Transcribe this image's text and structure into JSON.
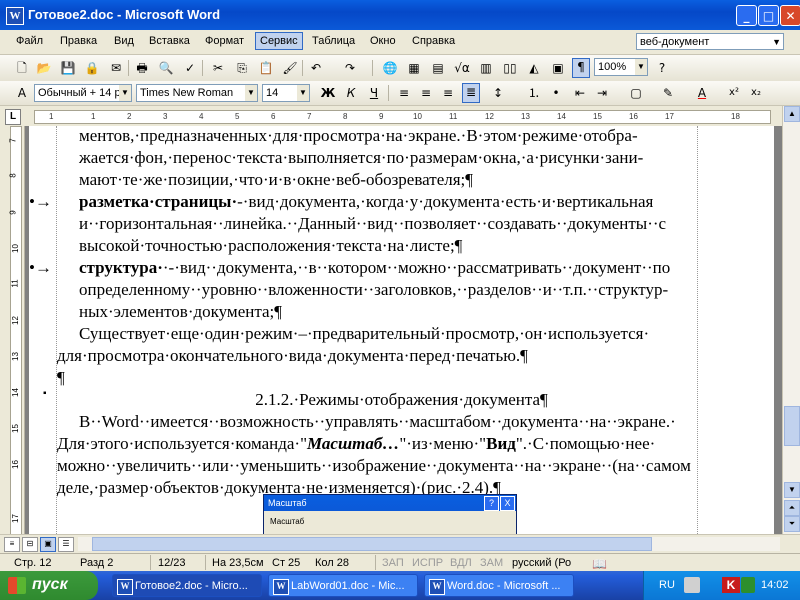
{
  "window": {
    "title": "Готовое2.doc - Microsoft Word",
    "app_icon": "W",
    "minimize_glyph": "_",
    "maximize_glyph": "□",
    "close_glyph": "✕"
  },
  "menubar": {
    "items": [
      "Файл",
      "Правка",
      "Вид",
      "Вставка",
      "Формат",
      "Сервис",
      "Таблица",
      "Окно",
      "Справка"
    ],
    "active": "Сервис",
    "help_box": "веб-документ"
  },
  "toolbar": {
    "zoom": "100%",
    "style": "Обычный + 14 р",
    "font": "Times New Roman",
    "size": "14",
    "bold": "Ж",
    "italic": "К",
    "underline": "Ч"
  },
  "ruler": {
    "tab_marker": "L",
    "ticks": [
      "1",
      "1",
      "2",
      "3",
      "4",
      "5",
      "6",
      "7",
      "8",
      "9",
      "10",
      "11",
      "12",
      "13",
      "14",
      "15",
      "16",
      "17",
      "18"
    ]
  },
  "vruler": {
    "ticks": [
      "7",
      "8",
      "9",
      "10",
      "11",
      "12",
      "13",
      "14",
      "15",
      "16",
      "17"
    ]
  },
  "document": {
    "lines": [
      "ментов,·предназначенных·для·просмотра·на·экране.·В·этом·режиме·отобра-",
      "жается·фон,·перенос·текста·выполняется·по·размерам·окна,·а·рисунки·зани-",
      "мают·те·же·позиции,·что·и·в·окне·веб-обозревателя;¶"
    ],
    "bullet1": {
      "bold": "разметка·страницы·",
      "rest": "-·вид·документа,·когда·у·документа·есть·и·вертикальная",
      "line2": "и··горизонтальная··линейка.··Данный··вид··позволяет··создавать··документы··с",
      "line3": "высокой·точностью·расположения·текста·на·листе;¶"
    },
    "bullet2": {
      "bold": "структура·",
      "rest": "·-·вид··документа,··в··котором··можно··рассматривать··документ··по",
      "line2": "определенному··уровню··вложенности··заголовков,··разделов··и··т.п.··структур-",
      "line3": "ных·элементов·документа;¶"
    },
    "para1": "Существует·еще·один·режим·–·предварительный·просмотр,·он·используется·",
    "para1b": "для·просмотра·окончательного·вида·документа·перед·печатью.¶",
    "empty_para": "¶",
    "heading": "2.1.2.·Режимы·отображения·документа¶",
    "para2a": "В··Word··имеется··возможность··управлять··масштабом··документа··на··экране.·",
    "para2b_pre": "Для·этого·используется·команда·\"",
    "para2b_cmd": "Масштаб…",
    "para2b_mid": "\"·из·меню·\"",
    "para2b_menu": "Вид",
    "para2b_post": "\".·С·помощью·нее·",
    "para2c": "можно··увеличить··или··уменьшить··изображение··документа··на··экране··(на··самом",
    "para2d": "деле,·размер·объектов·документа·не·изменяется)·(рис.·2.4).¶",
    "bullet_glyph": "•→",
    "side_bullet": "▪"
  },
  "dialog": {
    "title": "Масштаб",
    "help": "?",
    "close": "X",
    "label": "Масштаб"
  },
  "status": {
    "page": "Стр. 12",
    "section": "Разд 2",
    "pages": "12/23",
    "at": "На 23,5см",
    "line": "Ст 25",
    "col": "Кол 28",
    "rec": "ЗАП",
    "trk": "ИСПР",
    "ext": "ВДЛ",
    "ovr": "ЗАМ",
    "lang": "русский (Ро"
  },
  "taskbar": {
    "start": "пуск",
    "tasks": [
      "Готовое2.doc - Micro...",
      "LabWord01.doc - Mic...",
      "Word.doc - Microsoft ..."
    ],
    "lang": "RU",
    "clock": "14:02"
  }
}
